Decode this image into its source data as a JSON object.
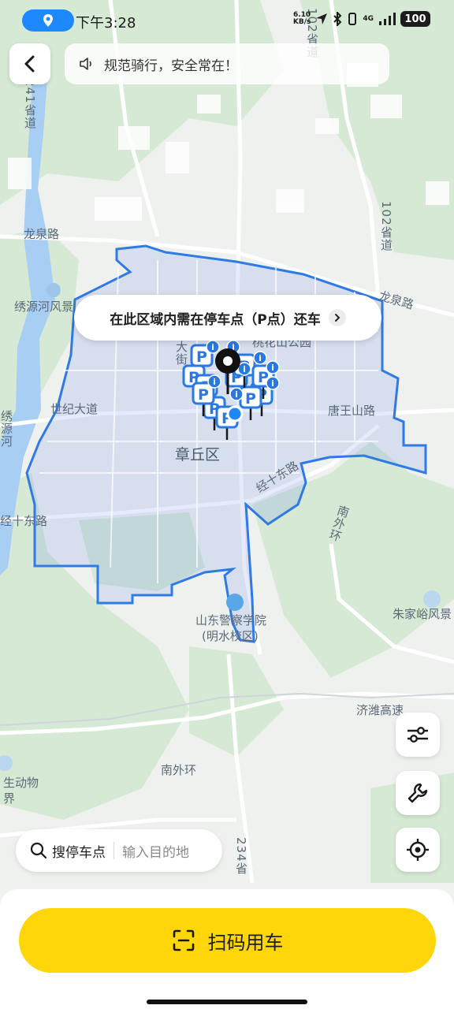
{
  "status_bar": {
    "time": "下午3:28",
    "net_speed_value": "6.10",
    "net_speed_unit": "KB/s",
    "network": "4G",
    "battery": "100"
  },
  "notice": {
    "text": "规范骑行，安全常在！"
  },
  "zone_banner": {
    "text": "在此区域内需在停车点（P点）还车"
  },
  "map": {
    "labels": {
      "road_102": "102省道",
      "road_241": "241省道",
      "longquan_w": "龙泉路",
      "longquan_e": "龙泉路",
      "road_102_e": "102省道",
      "xiuyuan": "绣源河风景",
      "shiji": "世纪大道",
      "taohua": "桃花山公园",
      "dajie": "大街",
      "tangwang": "唐王山路",
      "zhangqiu": "章丘区",
      "jingshi": "经十东路",
      "jingshi_w": "经十东路",
      "nanwaihuan_e": "南外环",
      "police": "山东警察学院",
      "police_campus": "(明水校区)",
      "zhujiayu": "朱家峪风景",
      "jinan_highway": "济潍高速",
      "nanwaihuan_s": "南外环",
      "zoo": "生动物",
      "zoo2": "界",
      "road_234": "234省",
      "xiu_v": "绣源河"
    },
    "parking_label": "P",
    "info_label": "i",
    "colors": {
      "zone_fill": "#6d8df0",
      "zone_stroke": "#2f7ae5",
      "parking": "#2a78e4",
      "road": "#ffffff",
      "green": "#d4e9d3"
    }
  },
  "search": {
    "label": "搜停车点",
    "placeholder": "输入目的地"
  },
  "main_action": {
    "label": "扫码用车"
  },
  "icons": {
    "location": "location-pin-icon",
    "back": "chevron-left-icon",
    "speaker": "speaker-icon",
    "filter": "filter-sliders-icon",
    "repair": "wrench-icon",
    "locate": "locate-crosshair-icon",
    "scan": "scan-icon",
    "search": "search-icon"
  }
}
